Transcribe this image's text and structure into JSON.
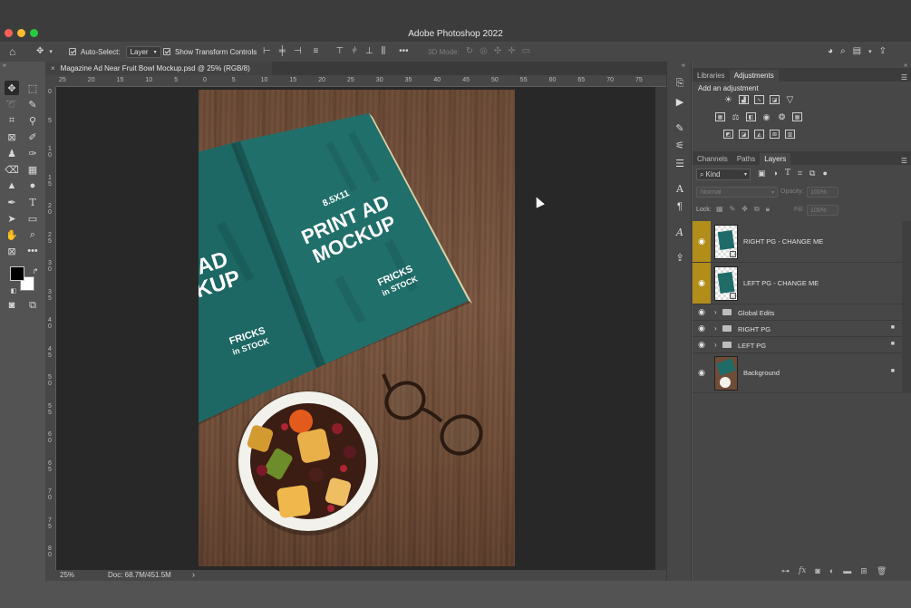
{
  "window": {
    "title": "Adobe Photoshop 2022"
  },
  "options_bar": {
    "auto_select_label": "Auto-Select:",
    "auto_select_value": "Layer",
    "show_transform_label": "Show Transform Controls",
    "mode_3d_label": "3D Mode:"
  },
  "document": {
    "tab_title": "Magazine Ad Near Fruit Bowl Mockup.psd @ 25% (RGB/8)",
    "zoom": "25%",
    "doc_info": "Doc: 68.7M/451.5M"
  },
  "ruler": {
    "h_ticks": [
      "25",
      "20",
      "15",
      "10",
      "5",
      "0",
      "5",
      "10",
      "15",
      "20",
      "25",
      "30",
      "35",
      "40",
      "45",
      "50",
      "55",
      "60",
      "65",
      "70",
      "75"
    ],
    "v_ticks": [
      "0",
      "5",
      "1\n0",
      "1\n5",
      "2\n0",
      "2\n5",
      "3\n0",
      "3\n5",
      "4\n0",
      "4\n5",
      "5\n0",
      "5\n5",
      "6\n0",
      "6\n5",
      "7\n0",
      "7\n5",
      "8\n0"
    ]
  },
  "artwork": {
    "size_text": "8.5X11",
    "headline_line1": "PRINT AD",
    "headline_line2": "MOCKUP",
    "left_headline_line1": "AD",
    "left_headline_line2": "CKUP",
    "brand_line1": "FRICKS",
    "brand_line2": "in STOCK",
    "magazine_color": "#1f6b68"
  },
  "panels": {
    "top_tabs": [
      "Libraries",
      "Adjustments"
    ],
    "active_top_tab": "Adjustments",
    "add_adjustment_label": "Add an adjustment",
    "layer_tabs": [
      "Channels",
      "Paths",
      "Layers"
    ],
    "active_layer_tab": "Layers",
    "filter_kind": "Kind",
    "blend_mode": "Normal",
    "opacity_label": "Opacity:",
    "opacity_value": "100%",
    "lock_label": "Lock:",
    "fill_label": "Fill:",
    "fill_value": "100%"
  },
  "layers": [
    {
      "name": "RIGHT PG - CHANGE ME",
      "type": "smart",
      "highlighted": true
    },
    {
      "name": "LEFT PG - CHANGE ME",
      "type": "smart",
      "highlighted": true
    },
    {
      "name": "Global Edits",
      "type": "group"
    },
    {
      "name": "RIGHT PG",
      "type": "group",
      "locked": true
    },
    {
      "name": "LEFT PG",
      "type": "group",
      "locked": true
    },
    {
      "name": "Background",
      "type": "image",
      "locked": true
    }
  ],
  "colors": {
    "highlight": "#b28d1a",
    "foreground": "#000000",
    "background": "#ffffff"
  }
}
